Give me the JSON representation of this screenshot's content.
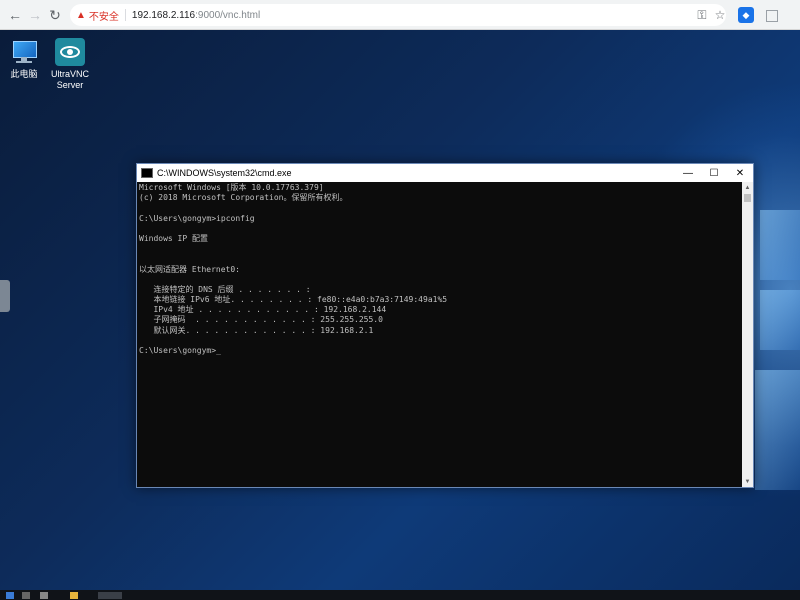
{
  "browser": {
    "security_label": "不安全",
    "url_host": "192.168.2.116",
    "url_path": ":9000/vnc.html",
    "icons": [
      "back-icon",
      "forward-icon",
      "reload-icon",
      "warning-icon",
      "key-icon",
      "star-icon",
      "extension-icon",
      "tab-icon"
    ]
  },
  "desktop": {
    "icons": [
      {
        "label": "此电脑",
        "icon": "computer-icon"
      },
      {
        "label": "UltraVNC Server",
        "icon": "ultravnc-icon"
      }
    ]
  },
  "cmd": {
    "title": "C:\\WINDOWS\\system32\\cmd.exe",
    "controls": {
      "minimize": "—",
      "maximize": "☐",
      "close": "✕"
    },
    "lines": [
      "Microsoft Windows [版本 10.0.17763.379]",
      "(c) 2018 Microsoft Corporation。保留所有权利。",
      "",
      "C:\\Users\\gongym>ipconfig",
      "",
      "Windows IP 配置",
      "",
      "",
      "以太网适配器 Ethernet0:",
      "",
      "   连接特定的 DNS 后缀 . . . . . . . :",
      "   本地链接 IPv6 地址. . . . . . . . : fe80::e4a0:b7a3:7149:49a1%5",
      "   IPv4 地址 . . . . . . . . . . . . : 192.168.2.144",
      "   子网掩码  . . . . . . . . . . . . : 255.255.255.0",
      "   默认网关. . . . . . . . . . . . . : 192.168.2.1",
      "",
      "C:\\Users\\gongym>_"
    ]
  }
}
